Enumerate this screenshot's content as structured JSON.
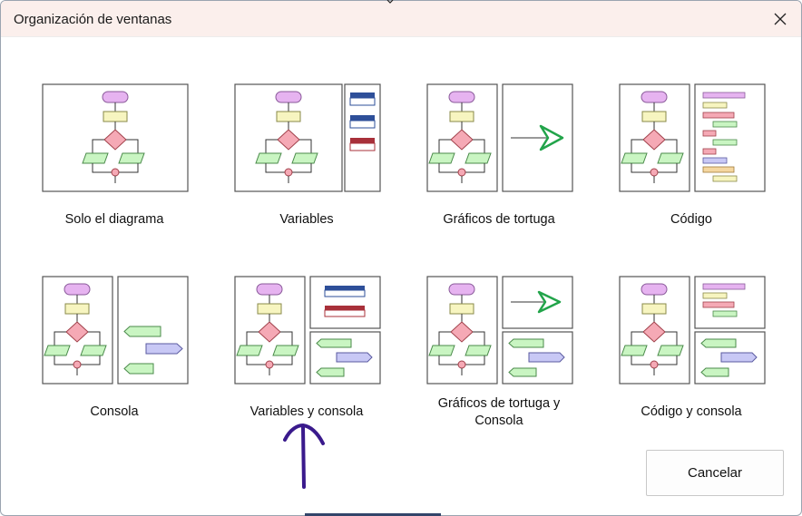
{
  "dialog": {
    "title": "Organización de ventanas",
    "cancel_label": "Cancelar"
  },
  "options": [
    {
      "id": "solo-diagrama",
      "label": "Solo el diagrama"
    },
    {
      "id": "variables",
      "label": "Variables"
    },
    {
      "id": "graficos-tortuga",
      "label": "Gráficos de tortuga"
    },
    {
      "id": "codigo",
      "label": "Código"
    },
    {
      "id": "consola",
      "label": "Consola"
    },
    {
      "id": "variables-consola",
      "label": "Variables y consola"
    },
    {
      "id": "graficos-tortuga-consola",
      "label": "Gráficos de tortuga y Consola"
    },
    {
      "id": "codigo-consola",
      "label": "Código y consola"
    }
  ],
  "colors": {
    "start_shape": "#e6b3f0",
    "process_shape": "#f7f5c0",
    "decision_shape": "#f5a9b5",
    "io_shape": "#c9f5c2",
    "variable_blue": "#2e4f99",
    "variable_red": "#a8303a",
    "turtle_arrow": "#22a44a",
    "console_out": "#c8c8f5",
    "annotation_ink": "#3a1a8c"
  },
  "icons": {
    "close": "close-icon",
    "annotation": "hand-drawn-up-arrow-icon"
  }
}
